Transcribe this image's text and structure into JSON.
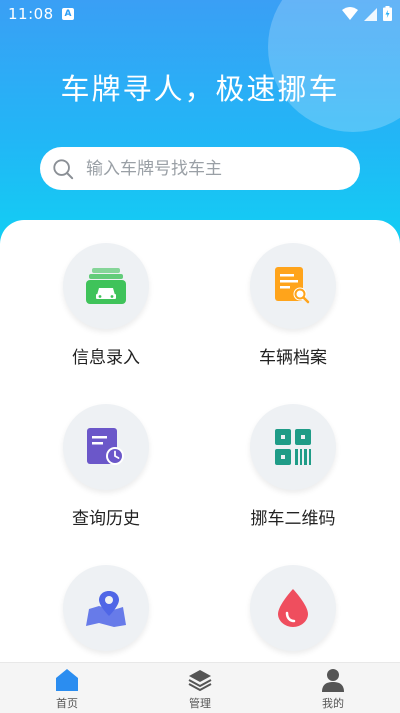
{
  "status_bar": {
    "time": "11:08",
    "notification_badge": "A"
  },
  "hero": {
    "headline": "车牌寻人，极速挪车"
  },
  "search": {
    "placeholder": "输入车牌号找车主"
  },
  "features": [
    {
      "label": "信息录入",
      "icon": "car-entry-icon",
      "color": "#3fc35a"
    },
    {
      "label": "车辆档案",
      "icon": "document-search-icon",
      "color": "#ffa41b"
    },
    {
      "label": "查询历史",
      "icon": "history-clock-icon",
      "color": "#6b57c9"
    },
    {
      "label": "挪车二维码",
      "icon": "qr-code-icon",
      "color": "#1f9c87"
    },
    {
      "label": "",
      "icon": "map-location-icon",
      "color": "#4f66e6"
    },
    {
      "label": "",
      "icon": "drop-icon",
      "color": "#ef4e5e"
    }
  ],
  "tabbar": {
    "tabs": [
      {
        "label": "首页",
        "icon": "home-icon",
        "active": true
      },
      {
        "label": "管理",
        "icon": "layers-icon",
        "active": false
      },
      {
        "label": "我的",
        "icon": "user-icon",
        "active": false
      }
    ]
  },
  "colors": {
    "accent": "#2b8df0",
    "gradient_top": "#3a9ff5",
    "gradient_bottom": "#11d0f3"
  }
}
